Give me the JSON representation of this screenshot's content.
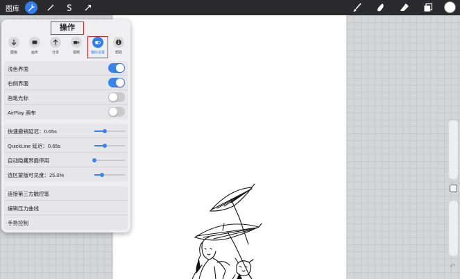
{
  "topbar": {
    "gallery": "图库",
    "tools_left": [
      {
        "name": "actions-wrench-icon",
        "active": true
      },
      {
        "name": "adjustments-wand-icon",
        "active": false
      },
      {
        "name": "selection-s-icon",
        "active": false
      },
      {
        "name": "transform-arrow-icon",
        "active": false
      }
    ],
    "tools_right": [
      "brush-icon",
      "smudge-icon",
      "eraser-icon",
      "layers-icon"
    ],
    "color_well": "#ffffff"
  },
  "panel": {
    "title": "操作",
    "tabs": [
      {
        "label": "图像",
        "icon": "add-arrow-icon",
        "active": false
      },
      {
        "label": "画布",
        "icon": "canvas-icon",
        "active": false
      },
      {
        "label": "分享",
        "icon": "share-icon",
        "active": false
      },
      {
        "label": "视频",
        "icon": "video-icon",
        "active": false
      },
      {
        "label": "偏好设置",
        "icon": "prefs-toggle-icon",
        "active": true
      },
      {
        "label": "帮助",
        "icon": "info-icon",
        "active": false
      }
    ],
    "toggles": [
      {
        "label": "浅色界面",
        "on": true
      },
      {
        "label": "右侧界面",
        "on": true
      },
      {
        "label": "画笔光标",
        "on": false
      },
      {
        "label": "AirPlay 画布",
        "on": false
      }
    ],
    "sliders": [
      {
        "label": "快速撤销延迟：0.65s",
        "value": 0.35
      },
      {
        "label": "QuickLine 延迟：0.65s",
        "value": 0.35
      },
      {
        "label": "自动隐藏界面停用",
        "value": 0.0
      },
      {
        "label": "选区蒙版可见度：25.0%",
        "value": 0.25
      }
    ],
    "links": [
      {
        "label": "连接第三方触控笔"
      },
      {
        "label": "编辑压力曲线"
      },
      {
        "label": "手势控制"
      }
    ]
  },
  "colors": {
    "accent": "#3a84f0",
    "highlight": "#d9252a"
  }
}
